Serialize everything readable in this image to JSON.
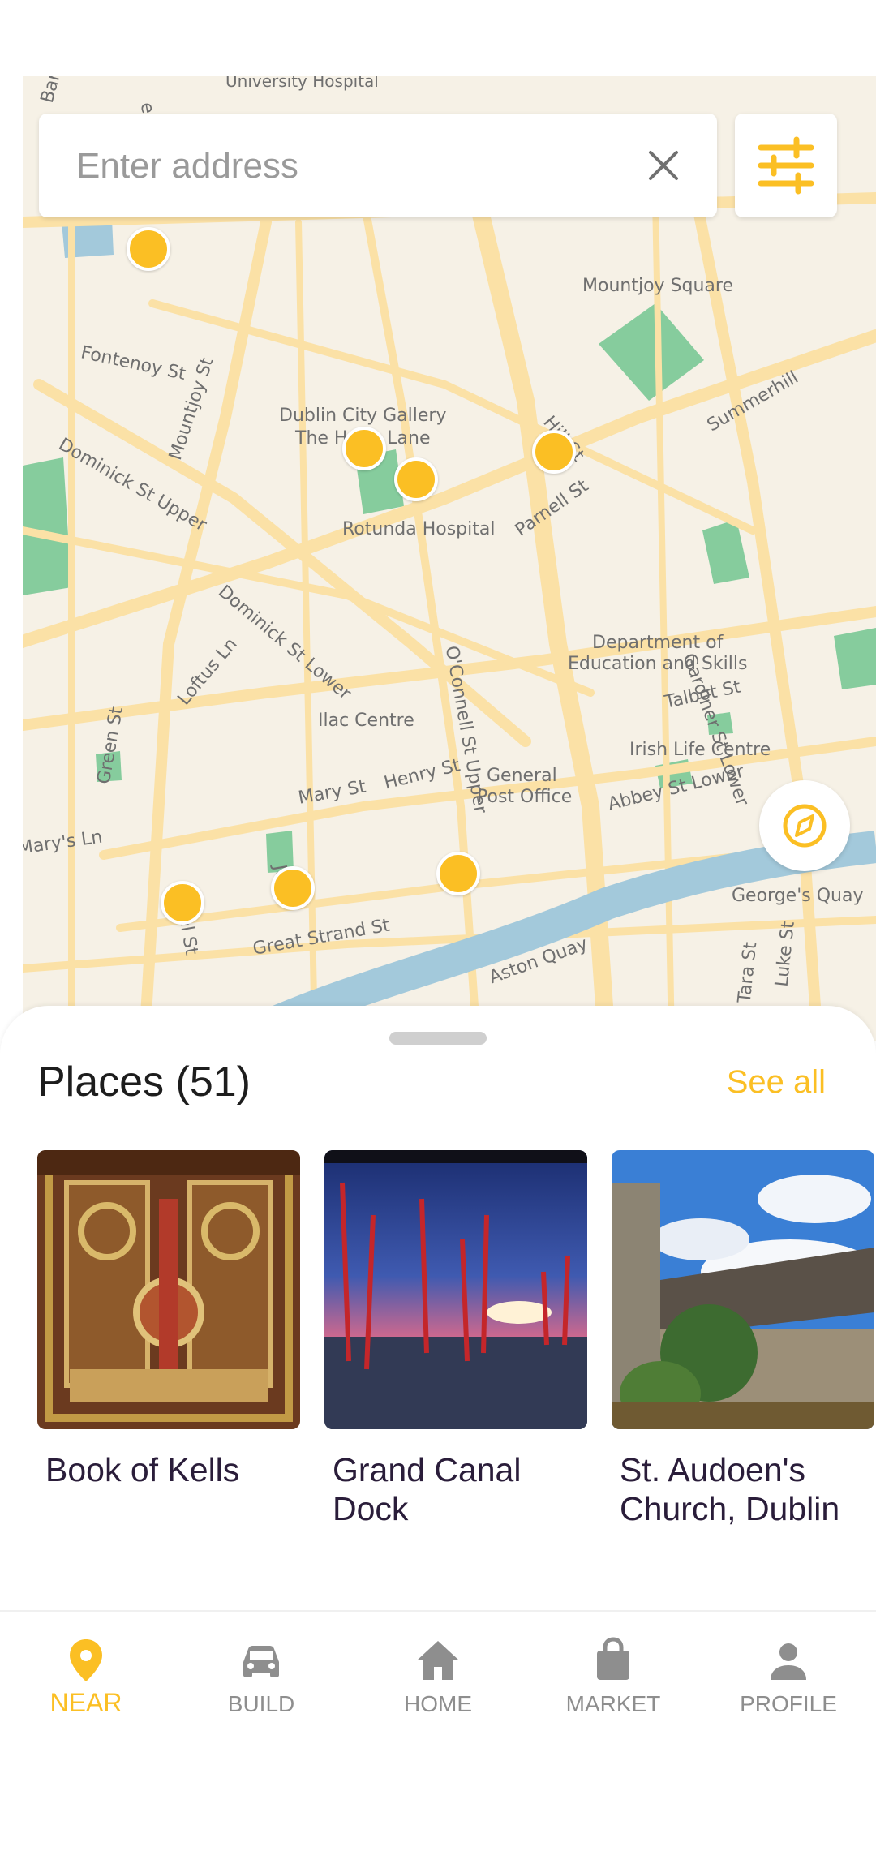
{
  "search": {
    "placeholder": "Enter address"
  },
  "map": {
    "labels": {
      "university_hospital": "University Hospital",
      "fontenoy": "Fontenoy St",
      "mountjoy_st": "Mountjoy St",
      "mountjoy_square": "Mountjoy Square",
      "dublin_city_gallery": "Dublin City Gallery",
      "hugh_lane": "The Hugh Lane",
      "dominick_upper": "Dominick St Upper",
      "hill_st": "Hill St",
      "summerhill": "Summerhill",
      "parnell": "Parnell St",
      "rotunda": "Rotunda Hospital",
      "dominick_lower": "Dominick St Lower",
      "oconnell": "O'Connell St Upper",
      "gardiner": "Gardiner St Lower",
      "department": "Department of",
      "education": "Education and Skills",
      "loftus": "Loftus Ln",
      "green_st": "Green St",
      "talbot": "Talbot St",
      "ilac": "Ilac Centre",
      "irish_life": "Irish Life Centre",
      "capel": "Capel St",
      "general": "General",
      "post_office": "Post Office",
      "henry": "Henry St",
      "mary": "Mary St",
      "abbey": "Abbey St Lower",
      "marys_ln": "Mary's Ln",
      "jervis": "Jer",
      "georges_quay": "George's Quay",
      "great_strand": "Great Strand St",
      "aston": "Aston Quay",
      "tara": "Tara St",
      "luke": "Luke St",
      "bank": "Bank",
      "york": "erk"
    }
  },
  "sheet": {
    "title": "Places (51)",
    "see_all": "See all",
    "places": [
      {
        "name": "Book of Kells"
      },
      {
        "name": "Grand Canal Dock"
      },
      {
        "name": "St. Audoen's Church, Dublin"
      }
    ]
  },
  "nav": {
    "items": [
      {
        "label": "NEAR",
        "icon": "location-pin-icon",
        "active": true
      },
      {
        "label": "BUILD",
        "icon": "car-icon",
        "active": false
      },
      {
        "label": "HOME",
        "icon": "home-icon",
        "active": false
      },
      {
        "label": "MARKET",
        "icon": "shopping-bag-icon",
        "active": false
      },
      {
        "label": "PROFILE",
        "icon": "person-icon",
        "active": false
      }
    ]
  },
  "colors": {
    "accent": "#fbbf24",
    "road": "#fbe1a6",
    "water": "#a3c9db",
    "park": "#86cc9d",
    "map_bg": "#f6f1e6"
  }
}
